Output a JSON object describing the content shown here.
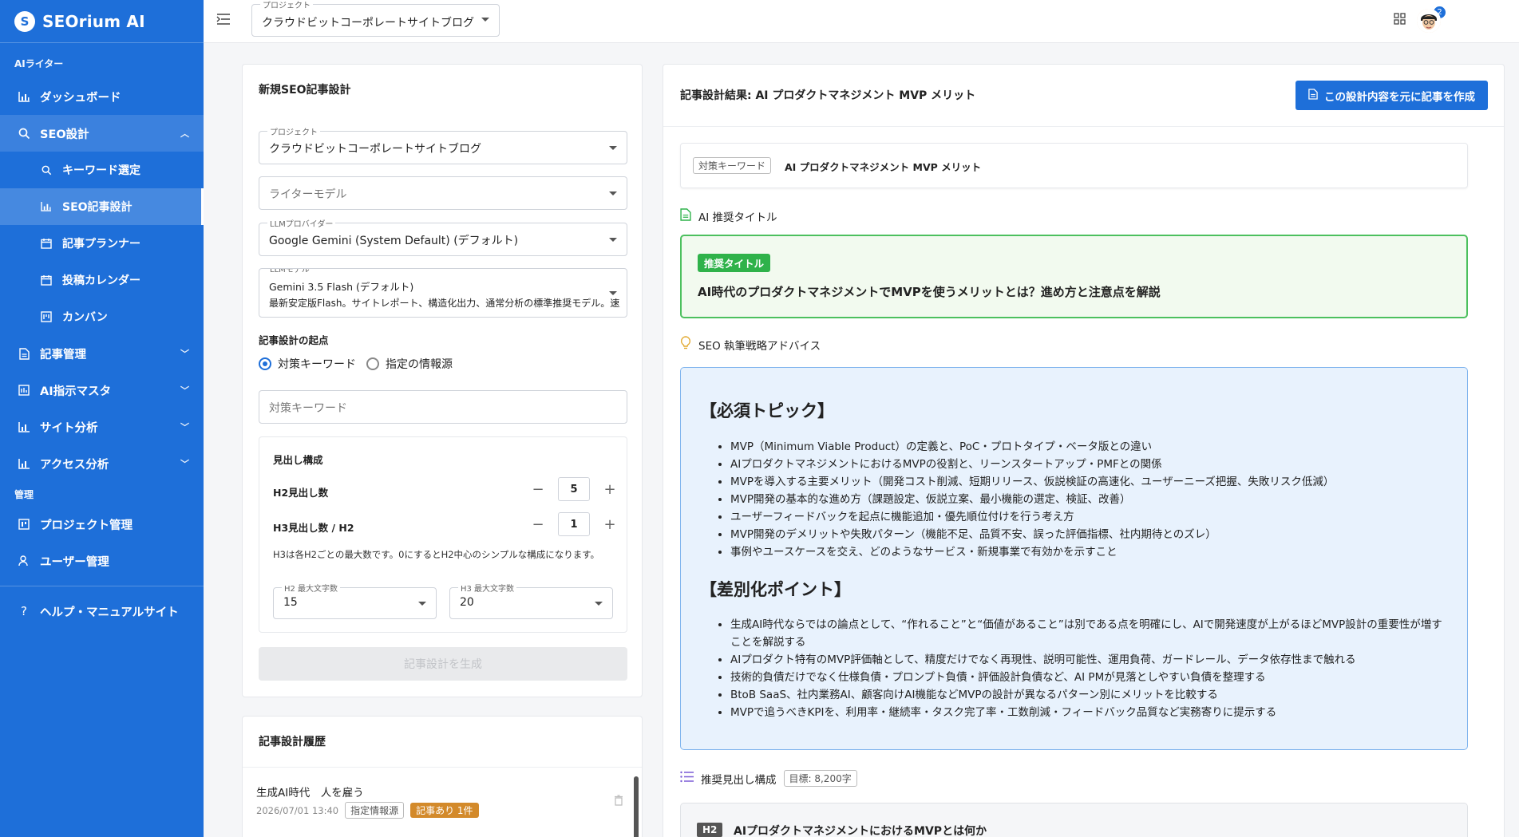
{
  "app": {
    "name": "SEOrium AI",
    "logo_letter": "S"
  },
  "sidebar": {
    "section_writer": "AIライター",
    "dashboard": "ダッシュボード",
    "seo_design": "SEO設計",
    "keyword_select": "キーワード選定",
    "seo_article_design": "SEO記事設計",
    "article_planner": "記事プランナー",
    "post_calendar": "投稿カレンダー",
    "kanban": "カンバン",
    "article_manage": "記事管理",
    "ai_master": "AI指示マスタ",
    "site_analysis": "サイト分析",
    "access_analysis": "アクセス分析",
    "section_admin": "管理",
    "project_manage": "プロジェクト管理",
    "user_manage": "ユーザー管理",
    "help": "ヘルプ・マニュアルサイト"
  },
  "topbar": {
    "project_label": "プロジェクト",
    "project_value": "クラウドビットコーポレートサイトブログ",
    "notification_count": "2"
  },
  "form": {
    "title": "新規SEO記事設計",
    "project_label": "プロジェクト",
    "project_value": "クラウドビットコーポレートサイトブログ",
    "writer_model_placeholder": "ライターモデル",
    "llm_provider_label": "LLMプロバイダー",
    "llm_provider_value": "Google Gemini (System Default) (デフォルト)",
    "llm_model_label": "LLMモデル",
    "llm_model_value": "Gemini 3.5 Flash (デフォルト)",
    "llm_model_desc": "最新安定版Flash。サイトレポート、構造化出力、通常分析の標準推奨モデル。速度",
    "origin_label": "記事設計の起点",
    "radio_keyword": "対策キーワード",
    "radio_source": "指定の情報源",
    "keyword_placeholder": "対策キーワード",
    "heading_section": "見出し構成",
    "h2_count_label": "H2見出し数",
    "h2_count": "5",
    "h3_count_label": "H3見出し数 / H2",
    "h3_count": "1",
    "h3_note": "H3は各H2ごとの最大数です。0にするとH2中心のシンプルな構成になります。",
    "h2_max_label": "H2 最大文字数",
    "h2_max": "15",
    "h3_max_label": "H3 最大文字数",
    "h3_max": "20",
    "generate_button": "記事設計を生成"
  },
  "history": {
    "title": "記事設計履歴",
    "item_title": "生成AI時代　人を雇う",
    "item_date": "2026/07/01 13:40",
    "item_tag": "指定情報源",
    "item_badge": "記事あり 1件"
  },
  "result": {
    "title": "記事設計結果: AI プロダクトマネジメント MVP メリット",
    "create_button": "この設計内容を元に記事を作成",
    "keyword_tag": "対策キーワード",
    "keyword_value": "AI プロダクトマネジメント MVP メリット",
    "ai_title_label": "AI 推奨タイトル",
    "recommended_badge": "推奨タイトル",
    "recommended_title": "AI時代のプロダクトマネジメントでMVPを使うメリットとは？進め方と注意点を解説",
    "advice_label": "SEO 執筆戦略アドバイス",
    "must_heading": "【必須トピック】",
    "must_items": [
      "MVP（Minimum Viable Product）の定義と、PoC・プロトタイプ・ベータ版との違い",
      "AIプロダクトマネジメントにおけるMVPの役割と、リーンスタートアップ・PMFとの関係",
      "MVPを導入する主要メリット（開発コスト削減、短期リリース、仮説検証の高速化、ユーザーニーズ把握、失敗リスク低減）",
      "MVP開発の基本的な進め方（課題設定、仮説立案、最小機能の選定、検証、改善）",
      "ユーザーフィードバックを起点に機能追加・優先順位付けを行う考え方",
      "MVP開発のデメリットや失敗パターン（機能不足、品質不安、誤った評価指標、社内期待とのズレ）",
      "事例やユースケースを交え、どのようなサービス・新規事業で有効かを示すこと"
    ],
    "diff_heading": "【差別化ポイント】",
    "diff_items": [
      "生成AI時代ならではの論点として、“作れること”と“価値があること”は別である点を明確にし、AIで開発速度が上がるほどMVP設計の重要性が増すことを解説する",
      "AIプロダクト特有のMVP評価軸として、精度だけでなく再現性、説明可能性、運用負荷、ガードレール、データ依存性まで触れる",
      "技術的負債だけでなく仕様負債・プロンプト負債・評価設計負債など、AI PMが見落としやすい負債を整理する",
      "BtoB SaaS、社内業務AI、顧客向けAI機能などMVPの設計が異なるパターン別にメリットを比較する",
      "MVPで追うべきKPIを、利用率・継続率・タスク完了率・工数削減・フィードバック品質など実務寄りに提示する"
    ],
    "outline_label": "推奨見出し構成",
    "outline_target": "目標: 8,200字",
    "h2_badge": "H2",
    "h2_first": "AIプロダクトマネジメントにおけるMVPとは何か"
  },
  "colors": {
    "accent": "#1e6fd9",
    "green": "#2fb24a",
    "advice_bg": "#e8f2fd"
  }
}
